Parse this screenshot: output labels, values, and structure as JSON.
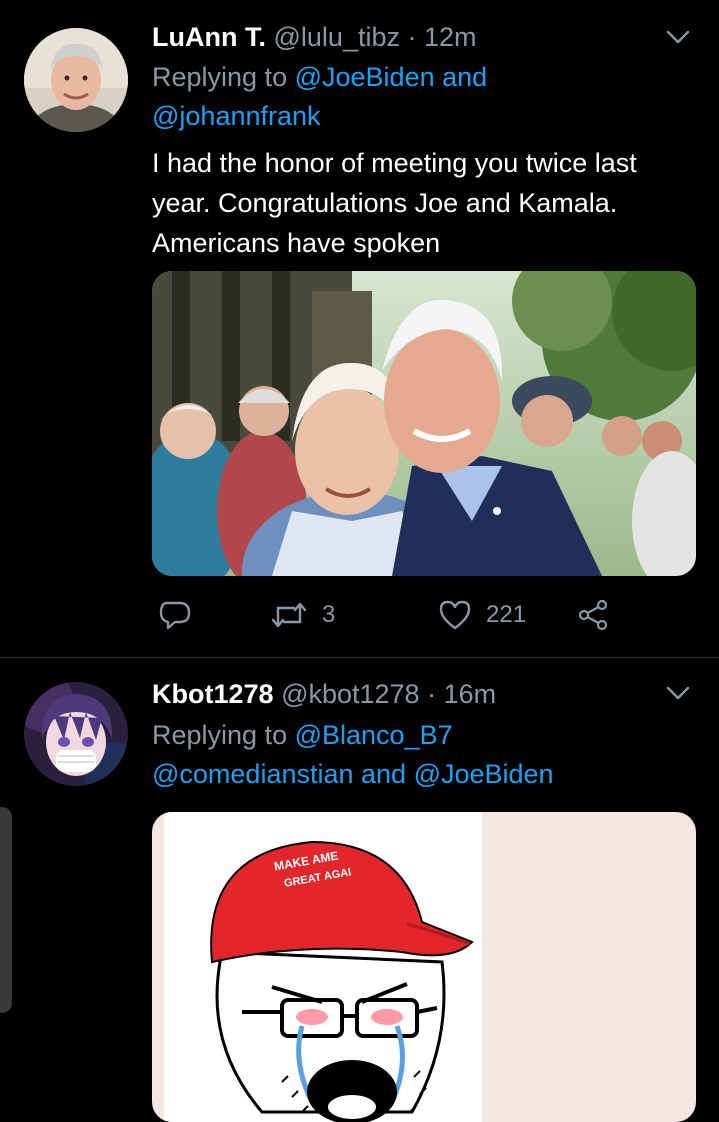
{
  "tweets": [
    {
      "name": "LuAnn T.",
      "handle": "@lulu_tibz",
      "separator": "·",
      "time": "12m",
      "replying_prefix": "Replying to",
      "replying_line1": "@JoeBiden and",
      "replying_line2": "@johannfrank",
      "text_lines": [
        "I had the honor of meeting you twice last",
        "year. Congratulations Joe and Kamala.",
        "Americans have spoken"
      ],
      "retweets": "3",
      "likes": "221",
      "icons": [
        "reply-icon",
        "retweet-icon",
        "like-icon",
        "share-icon",
        "chevron-down-icon"
      ]
    },
    {
      "name": "Kbot1278",
      "handle": "@kbot1278",
      "separator": "·",
      "time": "16m",
      "replying_prefix": "Replying to",
      "replying_line1": "@Blanco_B7",
      "replying_line2": "@comedianstian and @JoeBiden",
      "hat_text_line1": "MAKE AME",
      "hat_text_line2": "GREAT AGAI"
    }
  ],
  "colors": {
    "background": "#000000",
    "text": "#ffffff",
    "muted": "#8899a6",
    "link": "#1da1f2",
    "hat_red": "#e3262b",
    "meme_bg": "#f5e6e4"
  }
}
